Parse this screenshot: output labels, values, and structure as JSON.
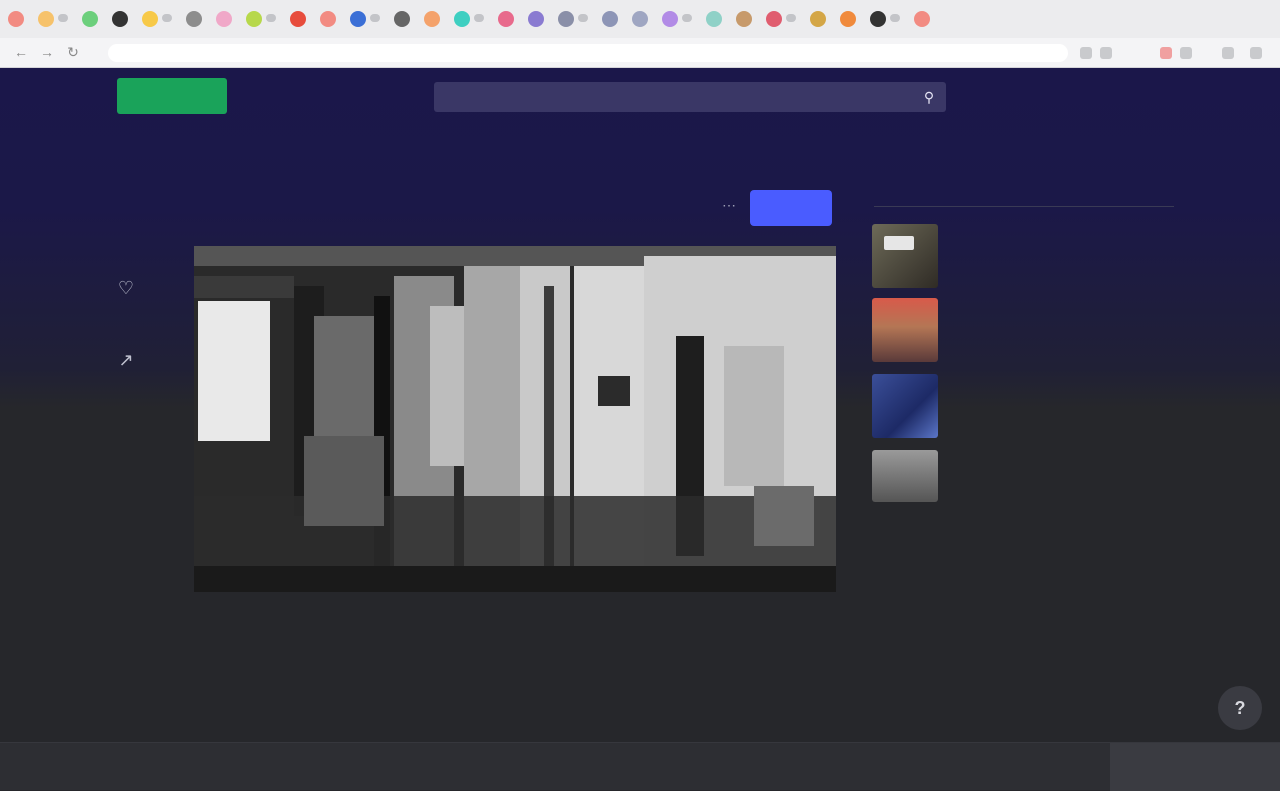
{
  "browser": {
    "tab_favicon_colors": [
      "#f28b82",
      "#f6c26b",
      "#6ccf7c",
      "#333333",
      "#f7c948",
      "#8d8d8d",
      "#f0a8c8",
      "#b7d84b",
      "#e74c3c",
      "#f28b82",
      "#3b6fd6",
      "#666666",
      "#f4a26b",
      "#3ecfc1",
      "#e86a8c",
      "#8a7bd1",
      "#8a8fa8",
      "#8d95b6",
      "#9fa6c2",
      "#b28be6",
      "#8fd1c7",
      "#c79a6b",
      "#e05d6f",
      "#d4a646",
      "#f08a3c",
      "#333333",
      "#f28b82"
    ],
    "address": "",
    "back_icon": "back-arrow-icon",
    "forward_icon": "forward-arrow-icon",
    "reload_icon": "reload-icon"
  },
  "header": {
    "logo_text": "",
    "upload_label": "",
    "search_placeholder": "",
    "search_icon": "search-icon",
    "accent_color": "#1aa35a"
  },
  "rail": {
    "items": [
      {
        "icon": "like-icon"
      },
      {
        "icon": "share-icon"
      }
    ]
  },
  "video": {
    "title": "",
    "follow_label": "",
    "follow_color": "#4a5cff",
    "more_icon": "more-icon"
  },
  "sidebar": {
    "heading": "",
    "items": [
      {
        "title": ""
      },
      {
        "title": ""
      },
      {
        "title": ""
      },
      {
        "title": ""
      }
    ]
  },
  "help": {
    "icon": "help-icon"
  },
  "footer": {
    "links": [
      "",
      "",
      "",
      "",
      "",
      "",
      "",
      "",
      "",
      "",
      "",
      "",
      ""
    ],
    "cta_label": ""
  }
}
